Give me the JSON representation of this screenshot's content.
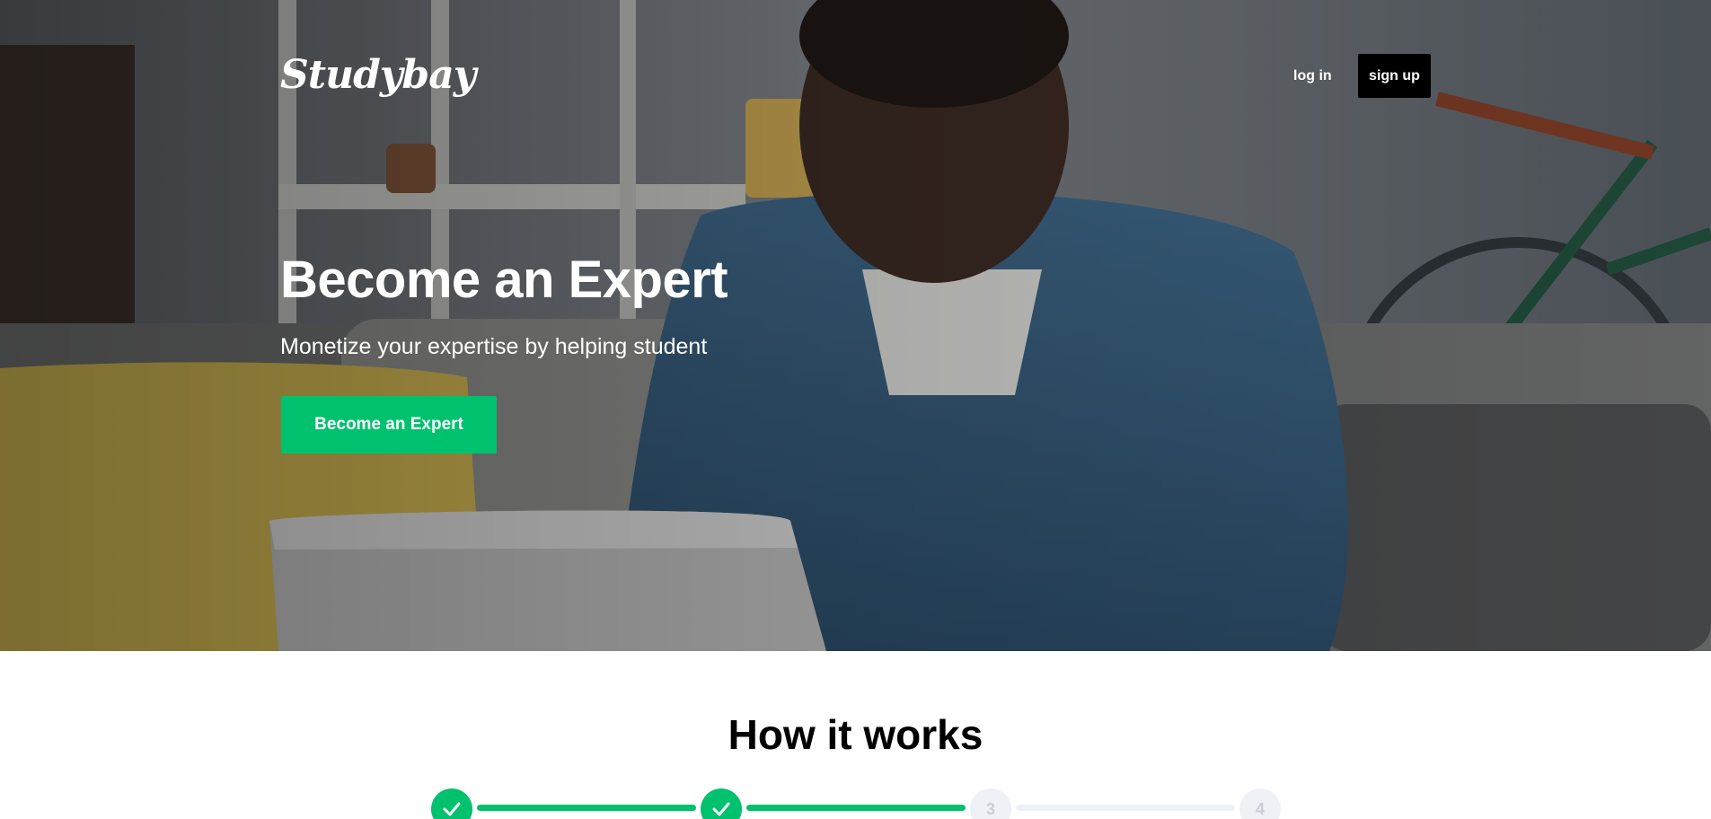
{
  "header": {
    "logo_text": "Studybay",
    "login_label": "log in",
    "signup_label": "sign up"
  },
  "hero": {
    "title": "Become an Expert",
    "subtitle": "Monetize your expertise by helping student",
    "cta_label": "Become an Expert",
    "photo_description_icon": "man-with-laptop-photo"
  },
  "how_it_works": {
    "title": "How it works",
    "steps": [
      {
        "label": "",
        "state": "completed",
        "icon": "check-icon"
      },
      {
        "label": "",
        "state": "completed",
        "icon": "check-icon"
      },
      {
        "label": "3",
        "state": "pending"
      },
      {
        "label": "4",
        "state": "pending"
      }
    ]
  },
  "colors": {
    "brand_green": "#00c16e",
    "signup_bg": "#000000",
    "pending_step": "#eef1f6",
    "pending_step_text": "#c9ced6"
  }
}
